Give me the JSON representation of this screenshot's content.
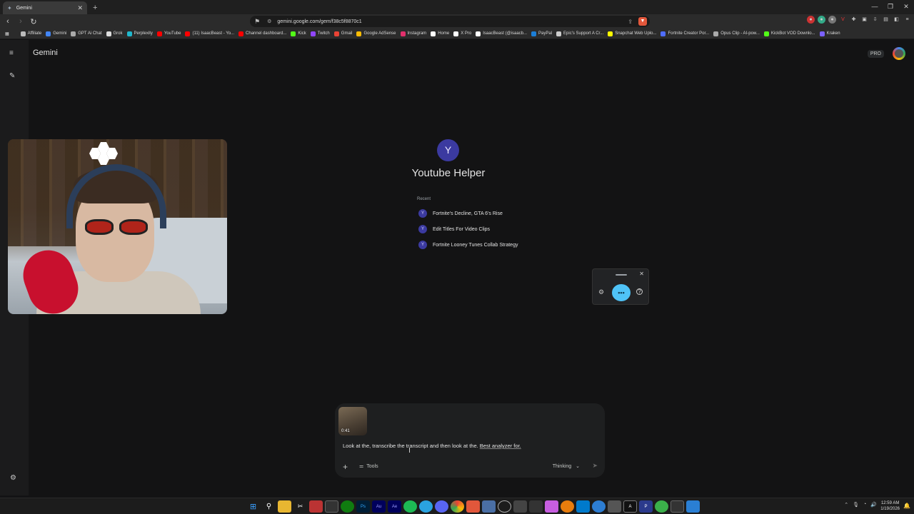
{
  "browser": {
    "tab_title": "Gemini",
    "url": "gemini.google.com/gem/f38c5f8870c1",
    "bookmarks": [
      {
        "label": "Affiliate",
        "color": "#bbbbbb"
      },
      {
        "label": "Gemini",
        "color": "#4285f4"
      },
      {
        "label": "GPT Ai Chat",
        "color": "#aaaaaa"
      },
      {
        "label": "Grok",
        "color": "#dddddd"
      },
      {
        "label": "Perplexity",
        "color": "#20b8cd"
      },
      {
        "label": "YouTube",
        "color": "#ff0000"
      },
      {
        "label": "(11) IsaacBeast - Yo...",
        "color": "#ff0000"
      },
      {
        "label": "Channel dashboard...",
        "color": "#ff0000"
      },
      {
        "label": "Kick",
        "color": "#53fc18"
      },
      {
        "label": "Twitch",
        "color": "#9146ff"
      },
      {
        "label": "Gmail",
        "color": "#ea4335"
      },
      {
        "label": "Google AdSense",
        "color": "#fbbc05"
      },
      {
        "label": "Instagram",
        "color": "#e1306c"
      },
      {
        "label": "Home",
        "color": "#ffffff"
      },
      {
        "label": "X Pro",
        "color": "#ffffff"
      },
      {
        "label": "IsaacBeast (@isaacb...",
        "color": "#ffffff"
      },
      {
        "label": "PayPal",
        "color": "#1c7ed6"
      },
      {
        "label": "Epic's Support A Cr...",
        "color": "#cccccc"
      },
      {
        "label": "Snapchat Web Uplo...",
        "color": "#fffc00"
      },
      {
        "label": "Fortnite Creator Por...",
        "color": "#4f6dff"
      },
      {
        "label": "Opus Clip - AI-pow...",
        "color": "#aaaaaa"
      },
      {
        "label": "KickBot VOD Downlo...",
        "color": "#53fc18"
      },
      {
        "label": "Kraken",
        "color": "#7b61ff"
      }
    ]
  },
  "app": {
    "brand": "Gemini",
    "plan_badge": "PRO",
    "gem_initial": "Y",
    "gem_title": "Youtube Helper",
    "recent_label": "Recent",
    "recent_items": [
      {
        "initial": "Y",
        "title": "Fortnite's Decline, GTA 6's Rise"
      },
      {
        "initial": "Y",
        "title": "Edit Titles For Video Clips"
      },
      {
        "initial": "Y",
        "title": "Fortnite Looney Tunes Collab Strategy"
      }
    ]
  },
  "composer": {
    "attachment_duration": "0:41",
    "prompt_main": "Look at the, transcribe the transcript and then look at the. ",
    "prompt_tail": "Best analyzer for.",
    "tools_label": "Tools",
    "mode_label": "Thinking"
  },
  "taskbar": {
    "time": "12:59 AM",
    "date": "1/19/2026"
  }
}
